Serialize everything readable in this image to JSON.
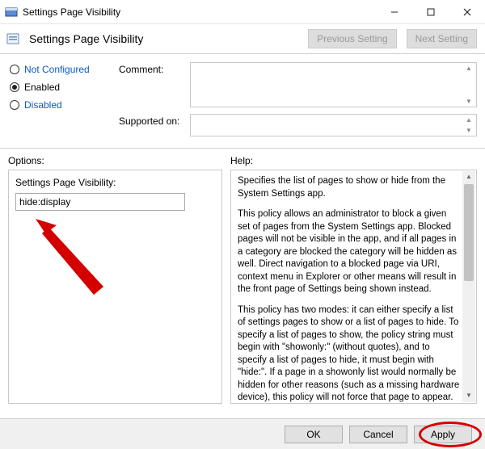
{
  "window": {
    "title": "Settings Page Visibility",
    "subtitle": "Settings Page Visibility",
    "prev_btn": "Previous Setting",
    "next_btn": "Next Setting"
  },
  "radios": {
    "not_configured": "Not Configured",
    "enabled": "Enabled",
    "disabled": "Disabled",
    "selected": "enabled"
  },
  "fields": {
    "comment_label": "Comment:",
    "comment_value": "",
    "supported_label": "Supported on:",
    "supported_value": ""
  },
  "section": {
    "options_label": "Options:",
    "help_label": "Help:"
  },
  "options": {
    "input_label": "Settings Page Visibility:",
    "input_value": "hide:display"
  },
  "help": {
    "p1": "Specifies the list of pages to show or hide from the System Settings app.",
    "p2": "This policy allows an administrator to block a given set of pages from the System Settings app. Blocked pages will not be visible in the app, and if all pages in a category are blocked the category will be hidden as well. Direct navigation to a blocked page via URI, context menu in Explorer or other means will result in the front page of Settings being shown instead.",
    "p3": "This policy has two modes: it can either specify a list of settings pages to show or a list of pages to hide. To specify a list of pages to show, the policy string must begin with \"showonly:\" (without quotes), and to specify a list of pages to hide, it must begin with \"hide:\". If a page in a showonly list would normally be hidden for other reasons (such as a missing hardware device), this policy will not force that page to appear. After this, the policy string must contain a semicolon-delimited list of settings page identifiers. The identifier for any given settings page is the published URI for that page, minus the \"ms-settings:\" protocol part."
  },
  "buttons": {
    "ok": "OK",
    "cancel": "Cancel",
    "apply": "Apply"
  }
}
